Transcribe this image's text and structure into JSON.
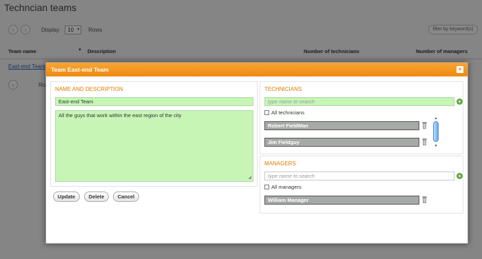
{
  "background": {
    "title": "Techncian teams",
    "pager": {
      "prev": "‹",
      "next": "›",
      "display_label": "Display",
      "rows_value": "10",
      "rows_label": "Rows"
    },
    "filter_placeholder": "filter by keyword(s)",
    "columns": [
      "Team name",
      "Description",
      "Number of technicians",
      "Number of managers"
    ],
    "rows": [
      {
        "team_name": "East-end Team"
      }
    ],
    "pager2_rows_label": "Rov"
  },
  "modal": {
    "title": "Team East-end Team",
    "close_label": "×",
    "name_section": {
      "title": "NAME AND DESCRIPTION",
      "name_value": "East-end Team",
      "description_value": "All the guys that work within the east region of the city"
    },
    "technicians": {
      "title": "TECHNICIANS",
      "search_placeholder": "type name to search",
      "all_label": "All technicians",
      "items": [
        "Robert FieldMan",
        "Jim Fieldguy"
      ]
    },
    "managers": {
      "title": "MANAGERS",
      "search_placeholder": "type name to search",
      "all_label": "All managers",
      "items": [
        "William Manager"
      ]
    },
    "buttons": {
      "update": "Update",
      "delete": "Delete",
      "cancel": "Cancel"
    }
  },
  "colors": {
    "accent": "#ef8a10",
    "field_green": "#c6f5b6",
    "link": "#2a5db0"
  }
}
